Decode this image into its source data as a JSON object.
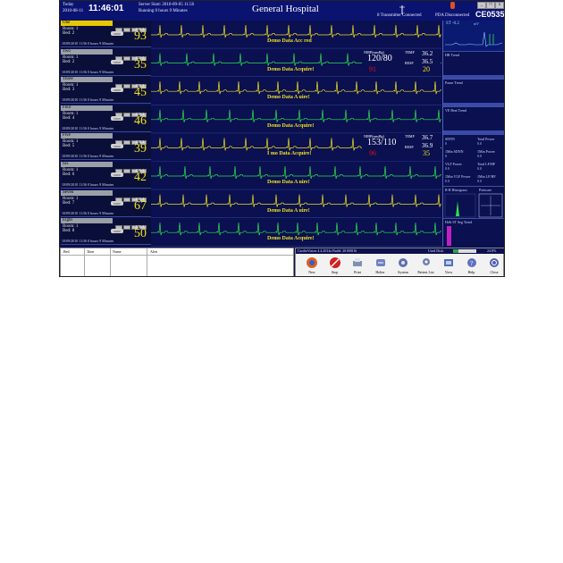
{
  "header": {
    "date_label": "Today",
    "date": "2010-08-11",
    "clock": "11:46:01",
    "server_start": "Server Start: 2010-09-05 11:56",
    "running": "Running 0 hours 9 Minutes",
    "hospital": "General Hospital",
    "transmitter": "8 Transmitter Connected",
    "pda": "PDA Disconnected",
    "ce_mark": "CE0535"
  },
  "patients": [
    {
      "name": "One",
      "room": "Room: 1",
      "bed": "Bed: 2",
      "time": "10/09/2010 11:56 0 hours 9 Minutes",
      "ch": "CH. I",
      "hr": "93",
      "selected": true,
      "demo": "Demo Data Acc   red"
    },
    {
      "name": "Two",
      "room": "Room: 1",
      "bed": "Bed: 2",
      "time": "10/09/2010 11:56 0 hours 9 Minutes",
      "ch": "CH. I",
      "hr": "35",
      "selected": false,
      "demo": "Demo Data Acquire!"
    },
    {
      "name": "Three",
      "room": "Room: 1",
      "bed": "Bed: 3",
      "time": "10/09/2010 11:56 0 hours 9 Minutes",
      "ch": "CH. I",
      "hr": "45",
      "selected": false,
      "demo": "Demo Data  A    uire!"
    },
    {
      "name": "Four",
      "room": "Room: 1",
      "bed": "Bed: 4",
      "time": "10/09/2010 11:56 0 hours 9 Minutes",
      "ch": "CH. I",
      "hr": "46",
      "selected": false,
      "demo": "Demo Data Acquire!"
    },
    {
      "name": "Five",
      "room": "Room: 1",
      "bed": "Bed: 5",
      "time": "10/09/2010 11:56 0 hours 9 Minutes",
      "ch": "CH. I",
      "hr": "39",
      "selected": false,
      "demo": "I  mo Data Acquire!"
    },
    {
      "name": "Six",
      "room": "Room: 1",
      "bed": "Bed: 6",
      "time": "10/09/2010 11:56 0 hours 9 Minutes",
      "ch": "CH. I",
      "hr": "42",
      "selected": false,
      "demo": "Demo Data  A    uire!"
    },
    {
      "name": "Seven",
      "room": "Room: 1",
      "bed": "Bed: 7",
      "time": "10/09/2010 11:56 0 hours 9 Minutes",
      "ch": "CH. I",
      "hr": "67",
      "selected": false,
      "demo": "Demo Data  A    uire!"
    },
    {
      "name": "Eight",
      "room": "Room: 1",
      "bed": "Bed: 8",
      "time": "10/09/2010 11:56 0 hours 9 Minutes",
      "ch": "CH. I",
      "hr": "50",
      "selected": false,
      "demo": "Demo Data Acquire!"
    }
  ],
  "vitals": [
    {
      "nibp_label": "NIBP(mmHg)",
      "temp_label": "TEMP",
      "resp_label": "RESP",
      "bp": "120/80",
      "temp1": "36.2",
      "temp2": "36.5",
      "spo2": "91",
      "resp": "20"
    },
    {
      "nibp_label": "NIBP(mmHg)",
      "temp_label": "TEMP",
      "resp_label": "RESP",
      "bp": "153/110",
      "temp1": "36.7",
      "temp2": "36.9",
      "spo2": "96",
      "resp": "35"
    }
  ],
  "right_panel": {
    "st_value": "ST -0.2",
    "st_unit": "mV",
    "hr_trend": "HR Trend",
    "pause_trend": "Pause Trend",
    "vebeat_trend": "VE Beat Trend",
    "stats": [
      {
        "label": "SDNN",
        "value": "0"
      },
      {
        "label": "Total Power",
        "value": "0.0"
      },
      {
        "label": "1Min SDNN",
        "value": "0"
      },
      {
        "label": "1Min Power",
        "value": "0.0"
      },
      {
        "label": "VLF Power",
        "value": "0.0"
      },
      {
        "label": "Total LF/HF",
        "value": "0.0"
      },
      {
        "label": "1Min VLF Power",
        "value": "0.0"
      },
      {
        "label": "1Min LF/HF",
        "value": "0.0"
      }
    ],
    "histogram_label": "R-R Histogram",
    "poincare_label": "Poincare",
    "st_trend_label": "Hr& ST Seg Trend"
  },
  "alarm_table": {
    "columns": [
      "Bed",
      "Time",
      "Name",
      "Alert"
    ]
  },
  "status_bar": {
    "version": "CardioVision 4.4.2014a  Build: 20100816",
    "disk": "Used Disk:",
    "percent": "24.8%"
  },
  "toolbar": [
    {
      "label": "New",
      "icon": "new-icon"
    },
    {
      "label": "Stop",
      "icon": "stop-icon"
    },
    {
      "label": "Print",
      "icon": "print-icon"
    },
    {
      "label": "Holter",
      "icon": "holter-icon"
    },
    {
      "label": "System",
      "icon": "system-icon"
    },
    {
      "label": "Patient List",
      "icon": "patient-list-icon"
    },
    {
      "label": "View",
      "icon": "view-icon"
    },
    {
      "label": "Help",
      "icon": "help-icon"
    },
    {
      "label": "Close",
      "icon": "close-icon"
    }
  ],
  "colors": {
    "background": "#0a1050",
    "waveform_yellow": "#f0e020",
    "waveform_green": "#30e050",
    "alarm_red": "#e01010"
  }
}
